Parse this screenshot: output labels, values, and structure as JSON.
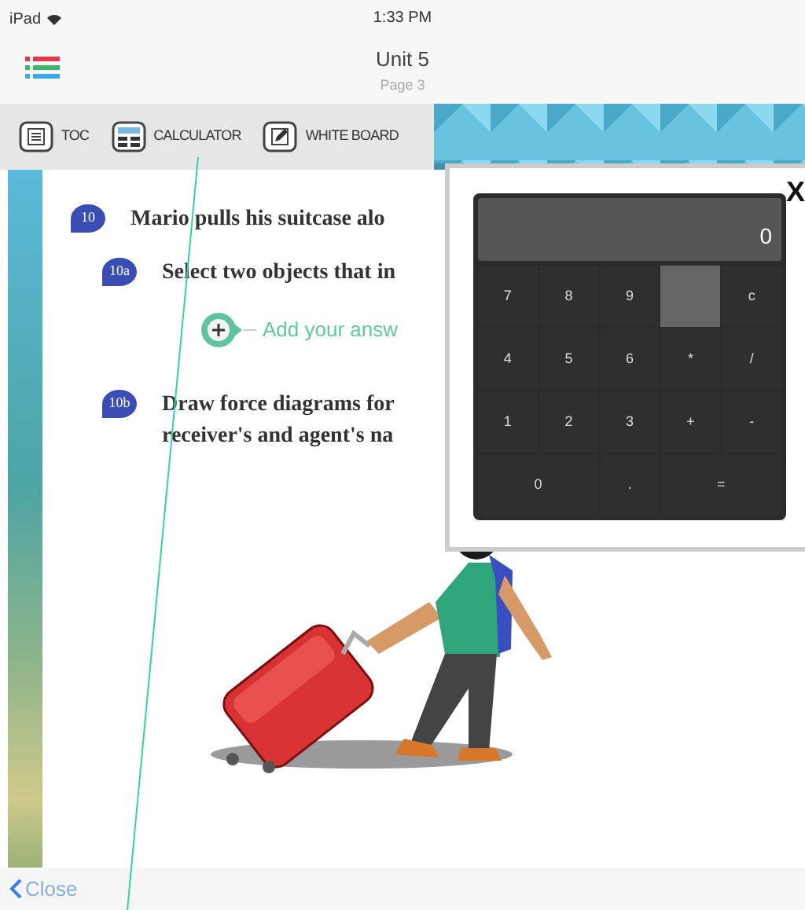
{
  "status_bar": {
    "device": "iPad",
    "time": "1:33 PM"
  },
  "header": {
    "title": "Unit 5",
    "subtitle": "Page 3"
  },
  "toolbar": [
    {
      "kind": "toc",
      "label": "TOC"
    },
    {
      "kind": "calculator",
      "label": "CALCULATOR"
    },
    {
      "kind": "whiteboard",
      "label": "WHITE BOARD"
    }
  ],
  "questions": [
    {
      "number": "10",
      "kind": "main",
      "lines": [
        "Mario pulls his suitcase alo"
      ]
    },
    {
      "number": "10a",
      "kind": "sub",
      "lines": [
        "Select two objects that in"
      ],
      "answer_prompt": "Add your answ"
    },
    {
      "number": "10b",
      "kind": "sub",
      "lines": [
        "Draw force diagrams for",
        "receiver's and agent's na"
      ]
    }
  ],
  "calculator": {
    "display": "0",
    "close": "X",
    "keys": [
      {
        "kind": "key",
        "label": "7"
      },
      {
        "kind": "key",
        "label": "8"
      },
      {
        "kind": "key",
        "label": "9"
      },
      {
        "kind": "blank"
      },
      {
        "kind": "key",
        "label": "c"
      },
      {
        "kind": "key",
        "label": "4"
      },
      {
        "kind": "key",
        "label": "5"
      },
      {
        "kind": "key",
        "label": "6"
      },
      {
        "kind": "key",
        "label": "*"
      },
      {
        "kind": "key",
        "label": "/"
      },
      {
        "kind": "key",
        "label": "1"
      },
      {
        "kind": "key",
        "label": "2"
      },
      {
        "kind": "key",
        "label": "3"
      },
      {
        "kind": "key",
        "label": "+"
      },
      {
        "kind": "key",
        "label": "-"
      },
      {
        "kind": "wide",
        "label": "0"
      },
      {
        "kind": "key",
        "label": "."
      },
      {
        "kind": "wide",
        "label": "="
      }
    ]
  },
  "footer": {
    "back": "Close"
  }
}
